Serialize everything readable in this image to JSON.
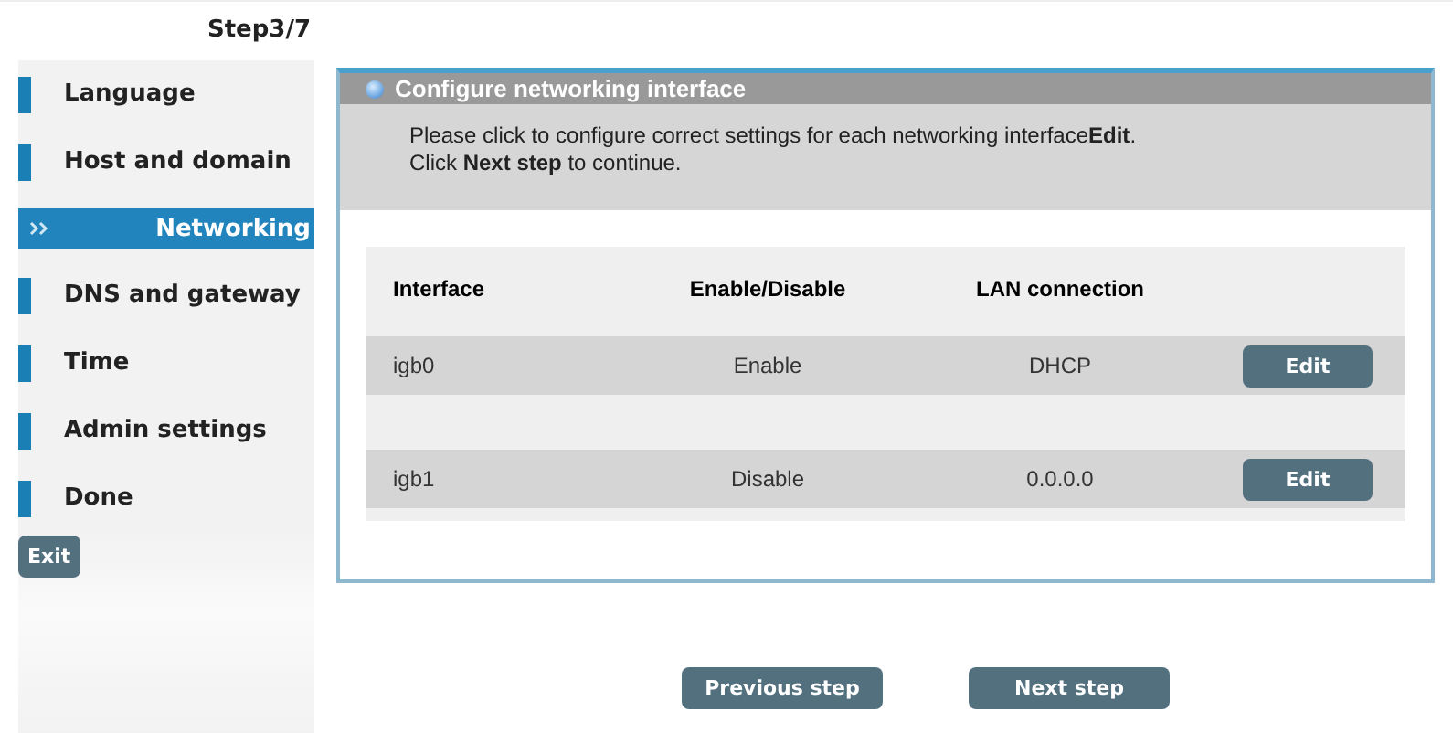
{
  "step": "Step3/7",
  "sidebar": {
    "items": [
      {
        "label": "Language",
        "selected": false
      },
      {
        "label": "Host and domain",
        "selected": false
      },
      {
        "label": "Networking",
        "selected": true
      },
      {
        "label": "DNS and gateway",
        "selected": false
      },
      {
        "label": "Time",
        "selected": false
      },
      {
        "label": "Admin settings",
        "selected": false
      },
      {
        "label": "Done",
        "selected": false
      }
    ],
    "exit_button": "Exit"
  },
  "panel": {
    "title": "Configure networking interface",
    "instructions": [
      "Please click to configure correct settings for each networking interface**Edit**.",
      "Click **Next step** to continue."
    ],
    "table": {
      "columns": [
        "Interface",
        "Enable/Disable",
        "LAN connection"
      ],
      "rows": [
        {
          "interface": "igb0",
          "state": "Enable",
          "lan": "DHCP",
          "action": "Edit"
        },
        {
          "interface": "igb1",
          "state": "Disable",
          "lan": "0.0.0.0",
          "action": "Edit"
        }
      ]
    }
  },
  "buttons": [
    "Previous step",
    "Next step"
  ]
}
